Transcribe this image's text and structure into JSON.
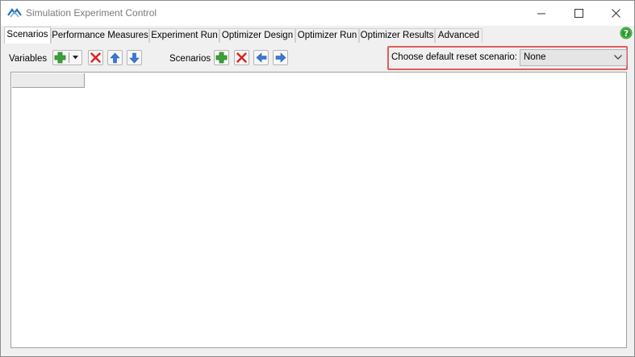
{
  "window": {
    "title": "Simulation Experiment Control",
    "controls": [
      "minimize",
      "maximize",
      "close"
    ]
  },
  "tabs": [
    {
      "label": "Scenarios",
      "active": true
    },
    {
      "label": "Performance Measures",
      "active": false
    },
    {
      "label": "Experiment Run",
      "active": false
    },
    {
      "label": "Optimizer Design",
      "active": false
    },
    {
      "label": "Optimizer Run",
      "active": false
    },
    {
      "label": "Optimizer Results",
      "active": false
    },
    {
      "label": "Advanced",
      "active": false
    }
  ],
  "toolbar": {
    "variables_label": "Variables",
    "scenarios_label": "Scenarios",
    "variables_buttons": [
      "add-icon",
      "dropdown-arrow-icon",
      "remove-icon",
      "arrow-up-icon",
      "arrow-down-icon"
    ],
    "scenarios_buttons": [
      "add-icon",
      "remove-icon",
      "arrow-left-icon",
      "arrow-right-icon"
    ]
  },
  "reset_scenario": {
    "label": "Choose default reset scenario:",
    "selected": "None",
    "highlight_color": "#e05d5d"
  },
  "icons": {
    "help": "help-icon",
    "help_color": "#2d9c2d",
    "add_color": "#3aa335",
    "remove_color": "#e02020",
    "arrow_color": "#3a78d8"
  }
}
